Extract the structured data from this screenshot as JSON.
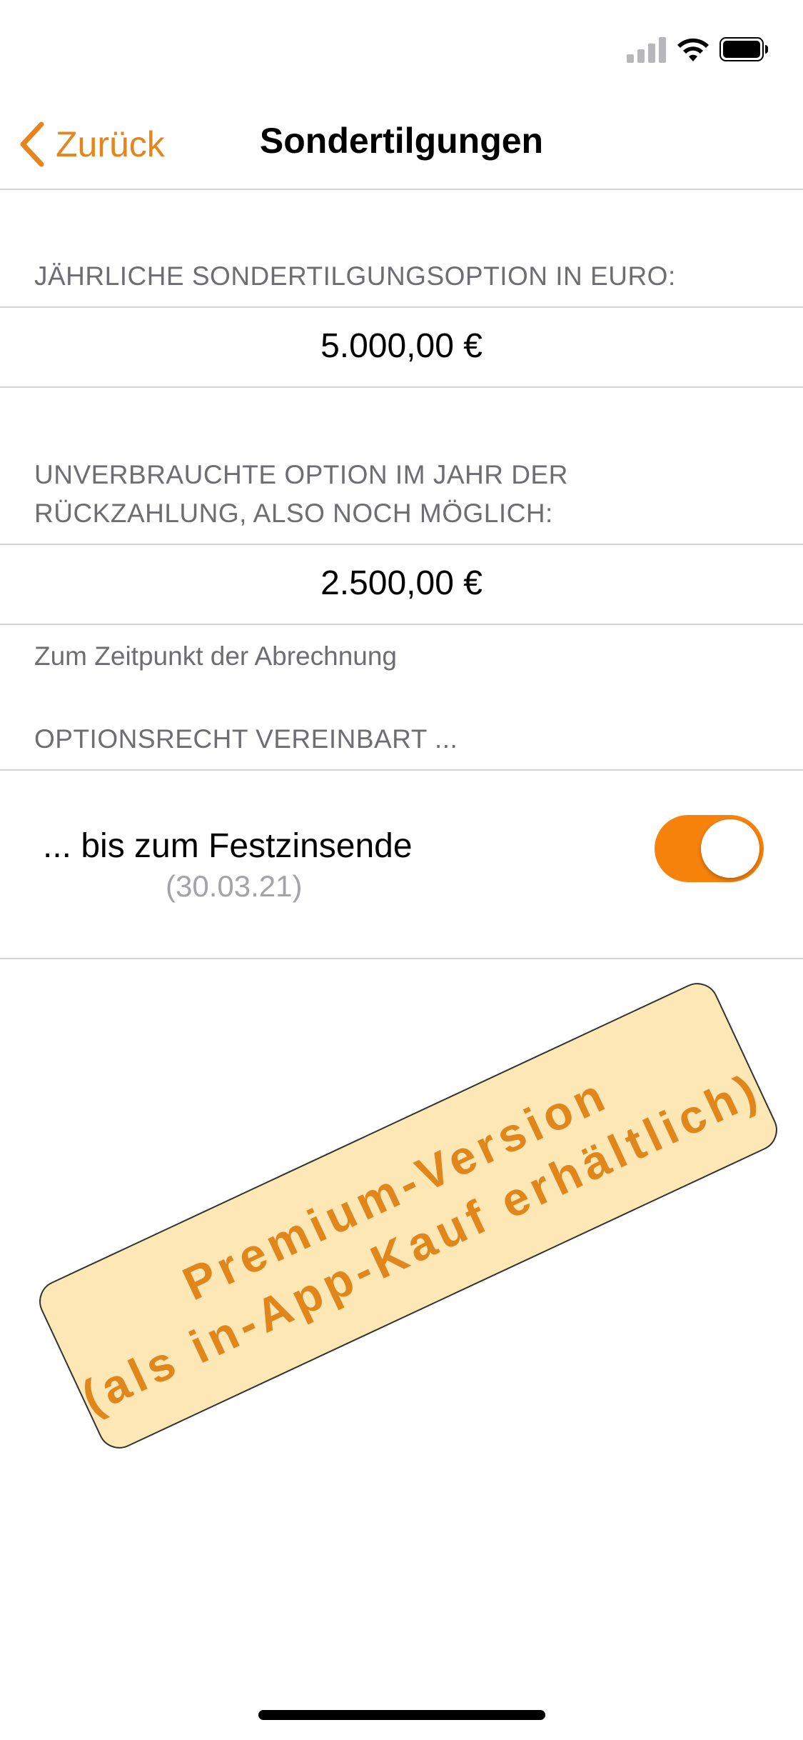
{
  "nav": {
    "back_label": "Zurück",
    "title": "Sondertilgungen"
  },
  "sections": {
    "annual_header": "JÄHRLICHE SONDERTILGUNGSOPTION IN EURO:",
    "annual_value": "5.000,00 €",
    "unused_header_line1": "UNVERBRAUCHTE OPTION IM JAHR DER",
    "unused_header_line2": "RÜCKZAHLUNG, ALSO NOCH MÖGLICH:",
    "unused_value": "2.500,00 €",
    "unused_footer": "Zum Zeitpunkt der Abrechnung",
    "option_header": "OPTIONSRECHT VEREINBART ...",
    "option_row_title": "... bis zum Festzinsende",
    "option_row_date": "(30.03.21)",
    "option_toggle_on": true
  },
  "premium": {
    "line1": "Premium-Version",
    "line2": "(als in-App-Kauf erhältlich)"
  },
  "colors": {
    "accent": "#e5851c",
    "toggle_on": "#f7820c",
    "banner_bg": "#fce7b5"
  }
}
